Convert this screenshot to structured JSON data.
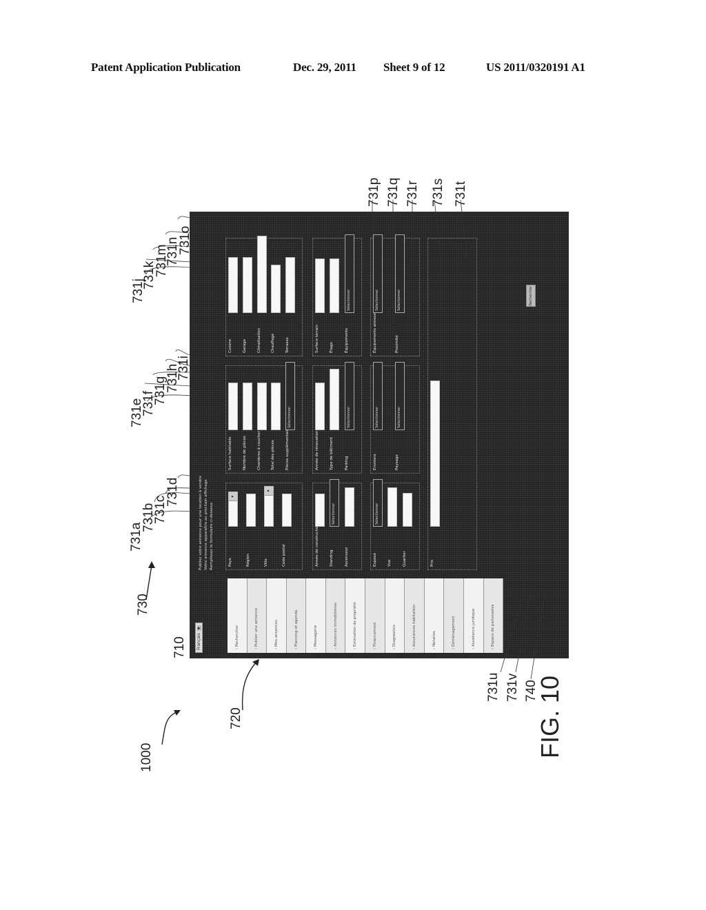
{
  "header": {
    "left": "Patent Application Publication",
    "date": "Dec. 29, 2011",
    "sheet": "Sheet 9 of 12",
    "number": "US 2011/0320191 A1"
  },
  "figure": {
    "caption": "FIG. 10",
    "ref_main": "1000",
    "ref_lang": "710",
    "ref_menu": "720",
    "ref_form": "730",
    "ref_search": "740",
    "field_refs": [
      "731a",
      "731b",
      "731c",
      "731d",
      "731e",
      "731f",
      "731g",
      "731h",
      "731i",
      "731j",
      "731k",
      "731m",
      "731n",
      "731o",
      "731p",
      "731q",
      "731r",
      "731s",
      "731t",
      "731u",
      "731v"
    ]
  },
  "ui": {
    "language": {
      "value": "Français",
      "arrow": "▼"
    },
    "intro_text": [
      "Publiez votre annonce pour une location à vendre",
      "Votre annonce apparaîtra au prochain affichage",
      "Remplissez le formulaire ci-dessous"
    ],
    "menu_items": [
      "› Rechercher",
      "› Publier une annonce",
      "› Mes annonces",
      "› Planning et agenda",
      "› Messagerie",
      "› Annonces immobilières",
      "› Estimation de propriété",
      "› Financement",
      "› Diagnostics",
      "› Assurances habitation",
      "› Notaires",
      "› Déménagement",
      "› Assistance juridique",
      "› Espace de partenaires"
    ],
    "groups": [
      {
        "fields": [
          {
            "label": "Pays",
            "value": "",
            "dropdown": true
          },
          {
            "label": "Région",
            "value": "",
            "dropdown": false
          },
          {
            "label": "Ville",
            "value": "",
            "dropdown": true
          },
          {
            "label": "Code postal",
            "value": "",
            "dropdown": false
          }
        ]
      },
      {
        "fields": [
          {
            "label": "Surface habitable",
            "value": ""
          },
          {
            "label": "Nombre de pièces",
            "value": ""
          },
          {
            "label": "Chambres à coucher",
            "value": ""
          },
          {
            "label": "Total des pièces",
            "value": ""
          },
          {
            "label": "Pièces supplémentaires",
            "value": "Sélectionner"
          }
        ]
      },
      {
        "fields": [
          {
            "label": "Cuisine",
            "value": ""
          },
          {
            "label": "Garage",
            "value": ""
          },
          {
            "label": "Climatisation",
            "value": ""
          },
          {
            "label": "Chauffage",
            "value": ""
          },
          {
            "label": "Terrasse",
            "value": ""
          }
        ]
      },
      {
        "fields": [
          {
            "label": "Année de construction",
            "value": ""
          },
          {
            "label": "Standing",
            "value": "Sélectionner"
          },
          {
            "label": "Ascenseur",
            "value": ""
          }
        ]
      },
      {
        "fields": [
          {
            "label": "Année de rénovation",
            "value": ""
          },
          {
            "label": "Type de bâtiment",
            "value": ""
          },
          {
            "label": "Parking",
            "value": "Sélectionner"
          }
        ]
      },
      {
        "fields": [
          {
            "label": "Surface terrain",
            "value": ""
          },
          {
            "label": "Étage",
            "value": ""
          },
          {
            "label": "Équipements",
            "value": "Sélectionner"
          }
        ]
      },
      {
        "fields": [
          {
            "label": "Exposé",
            "value": "Sélectionner"
          },
          {
            "label": "Vue",
            "value": ""
          },
          {
            "label": "Quartier",
            "value": ""
          }
        ]
      },
      {
        "fields": [
          {
            "label": "Environs",
            "value": "Sélectionner"
          },
          {
            "label": "Paysage",
            "value": "Sélectionner"
          }
        ]
      },
      {
        "fields": [
          {
            "label": "Équipements annexes",
            "value": "Sélectionner"
          },
          {
            "label": "Proximité",
            "value": "Sélectionner"
          }
        ]
      },
      {
        "fields": [
          {
            "label": "Prix",
            "value": "",
            "min": "",
            "max": ""
          }
        ]
      }
    ],
    "search_button": "Rechercher"
  }
}
